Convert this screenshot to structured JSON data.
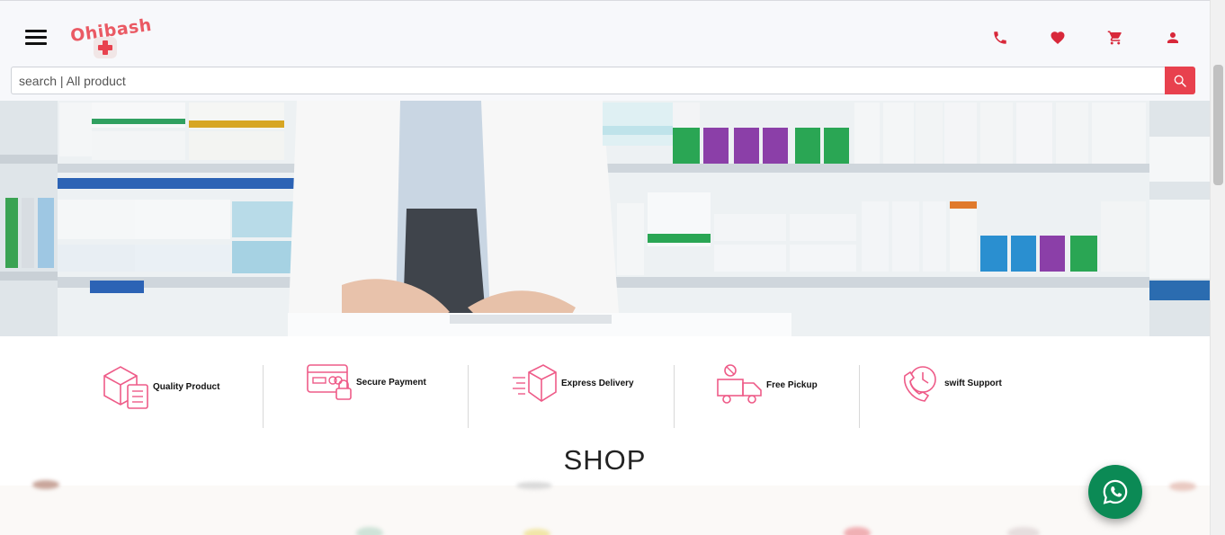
{
  "header": {
    "brand_name": "Ohibash",
    "menu_icon": "hamburger-menu-icon",
    "icons": [
      "phone-icon",
      "heart-icon",
      "cart-icon",
      "user-icon"
    ],
    "accent_color": "#e8414e"
  },
  "search": {
    "placeholder": "search | All product",
    "icon": "search-icon"
  },
  "hero": {
    "image": "pharmacist-at-pharmacy-counter"
  },
  "features": [
    {
      "label": "Quality Product",
      "icon": "quality-box-icon"
    },
    {
      "label": "Secure Payment",
      "icon": "secure-card-icon"
    },
    {
      "label": "Express Delivery",
      "icon": "express-delivery-icon"
    },
    {
      "label": "Free Pickup",
      "icon": "pickup-truck-icon"
    },
    {
      "label": "swift Support",
      "icon": "support-phone-icon"
    }
  ],
  "shop": {
    "title": "SHOP"
  },
  "floating": {
    "whatsapp_icon": "whatsapp-icon",
    "whatsapp_color": "#0b8a55"
  }
}
